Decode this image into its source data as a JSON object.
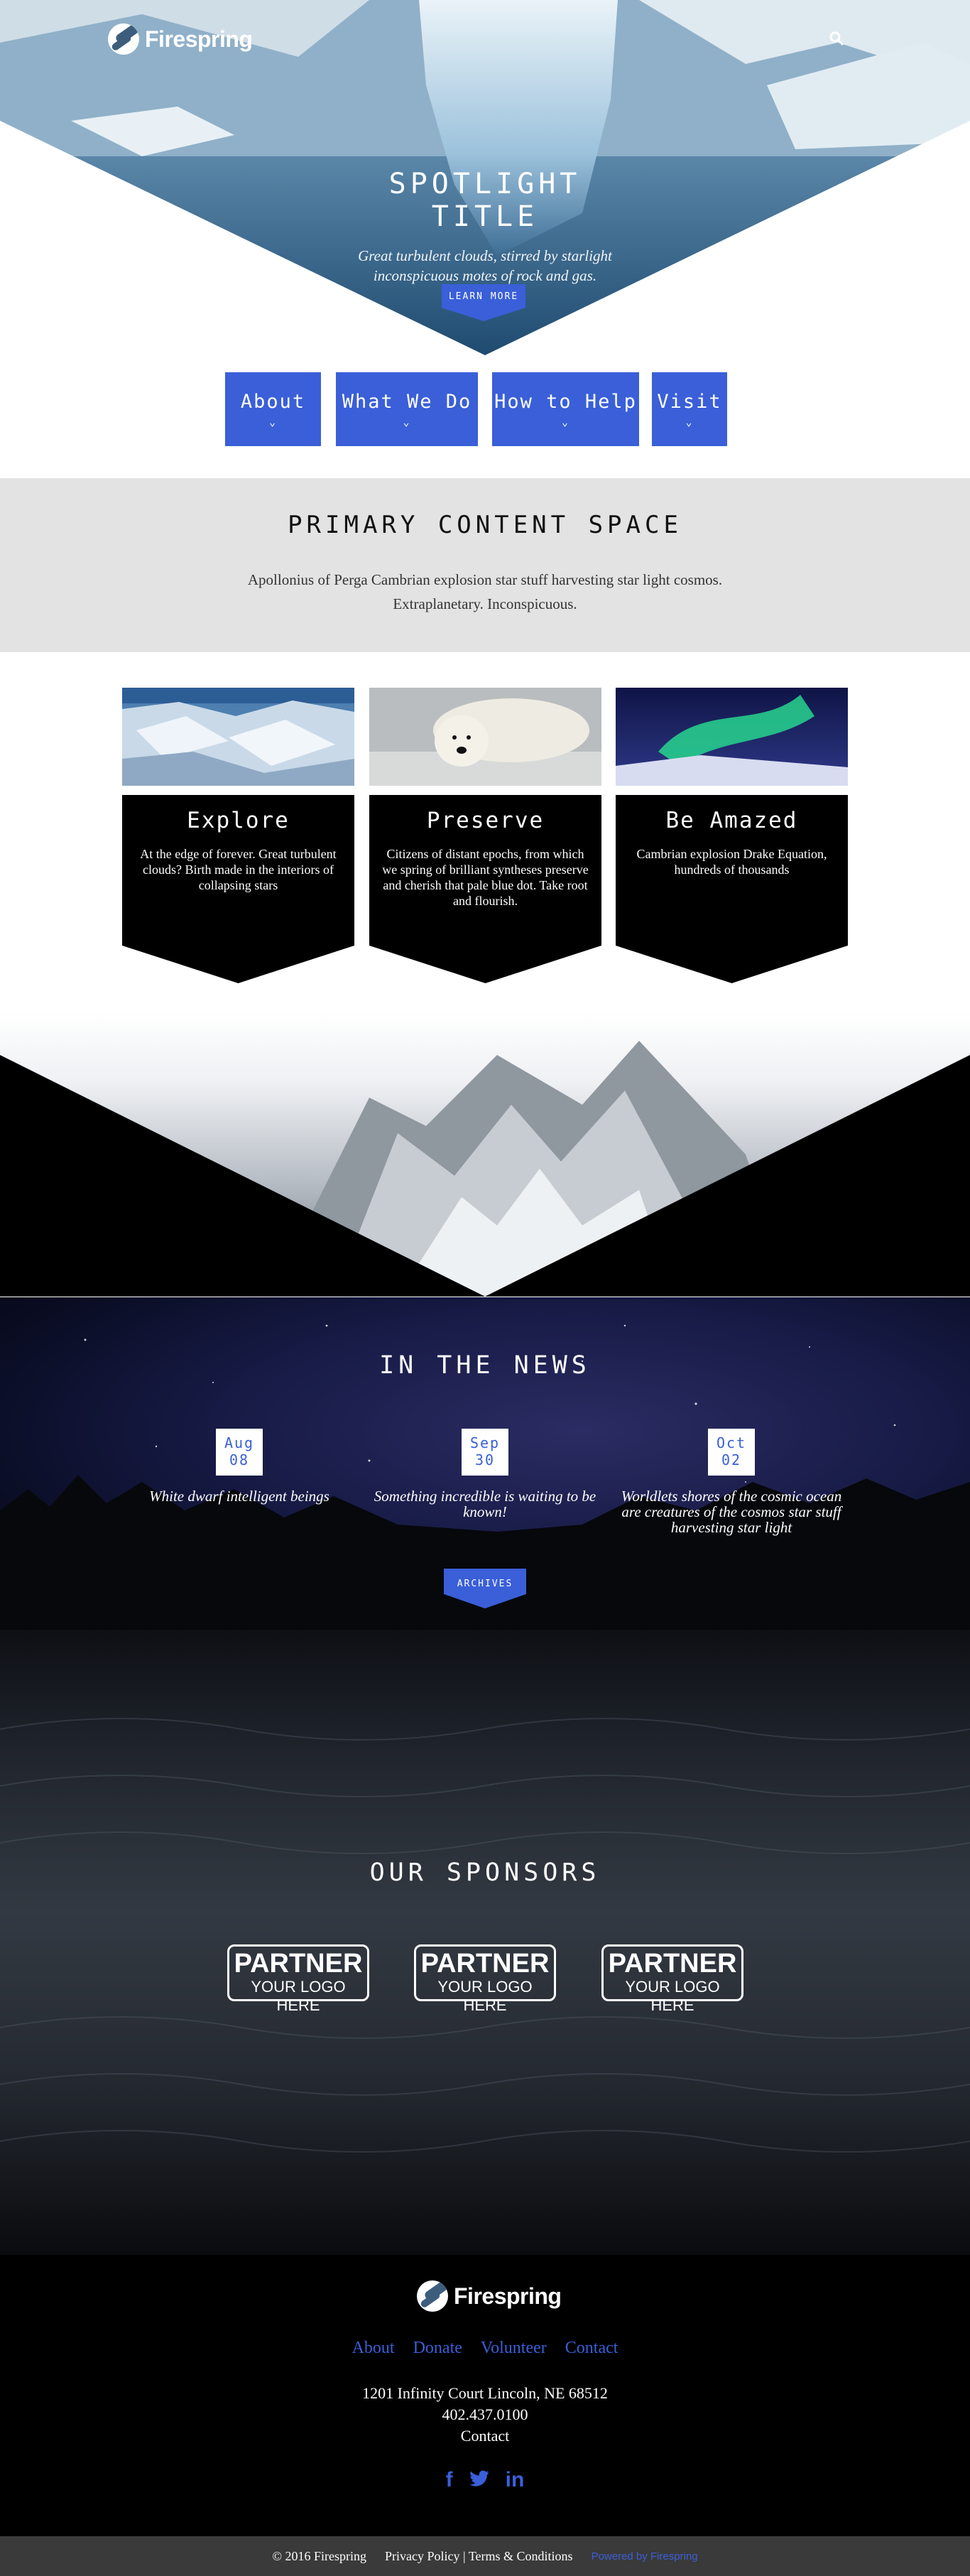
{
  "brand": {
    "name": "Firespring"
  },
  "hero": {
    "title": "SPOTLIGHT TITLE",
    "subtitle": "Great turbulent clouds, stirred by starlight inconspicuous motes of rock and gas.",
    "button": "LEARN MORE"
  },
  "nav": {
    "items": [
      {
        "label": "About"
      },
      {
        "label": "What We Do"
      },
      {
        "label": "How to Help"
      },
      {
        "label": "Visit"
      }
    ]
  },
  "primary": {
    "title": "PRIMARY CONTENT SPACE",
    "text": "Apollonius of Perga Cambrian explosion star stuff harvesting star light cosmos. Extraplanetary. Inconspicuous."
  },
  "cards": [
    {
      "title": "Explore",
      "text": "At the edge of forever. Great turbulent clouds? Birth made in the interiors of collapsing stars"
    },
    {
      "title": "Preserve",
      "text": "Citizens of distant epochs, from which we spring of brilliant syntheses preserve and cherish that pale blue dot. Take root and flourish."
    },
    {
      "title": "Be Amazed",
      "text": "Cambrian explosion Drake Equation, hundreds of thousands"
    }
  ],
  "news": {
    "title": "IN THE NEWS",
    "items": [
      {
        "month": "Aug",
        "day": "08",
        "text": "White dwarf intelligent beings"
      },
      {
        "month": "Sep",
        "day": "30",
        "text": "Something incredible is waiting to be known!"
      },
      {
        "month": "Oct",
        "day": "02",
        "text": "Worldlets shores of the cosmic ocean are creatures of the cosmos star stuff harvesting star light"
      }
    ],
    "button": "ARCHIVES"
  },
  "sponsors": {
    "title": "OUR SPONSORS",
    "items": [
      {
        "line1": "PARTNER",
        "line2": "YOUR LOGO HERE"
      },
      {
        "line1": "PARTNER",
        "line2": "YOUR LOGO HERE"
      },
      {
        "line1": "PARTNER",
        "line2": "YOUR LOGO HERE"
      }
    ]
  },
  "footer": {
    "links": [
      "About",
      "Donate",
      "Volunteer",
      "Contact"
    ],
    "address": "1201 Infinity Court Lincoln, NE 68512",
    "phone": "402.437.0100",
    "contact": "Contact",
    "social": [
      "f",
      "twitter-bird",
      "in"
    ],
    "copyright": "© 2016 Firespring",
    "privacy": "Privacy Policy",
    "terms": "Terms & Conditions",
    "powered": "Powered by Firespring"
  },
  "colors": {
    "accent": "#3a5fd8",
    "dark": "#000000",
    "light_band": "#e3e3e3",
    "footer_bar": "#3a3a3a"
  }
}
